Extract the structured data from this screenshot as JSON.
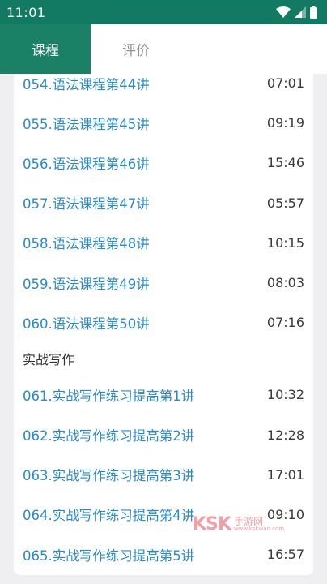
{
  "status_bar": {
    "time": "11:01"
  },
  "tabs": [
    {
      "label": "课程",
      "active": true
    },
    {
      "label": "评价",
      "active": false
    }
  ],
  "list": {
    "partial_item": {
      "title": "054.语法课程第44讲",
      "duration": "07:01"
    },
    "items_a": [
      {
        "title": "055.语法课程第45讲",
        "duration": "09:19"
      },
      {
        "title": "056.语法课程第46讲",
        "duration": "15:46"
      },
      {
        "title": "057.语法课程第47讲",
        "duration": "05:57"
      },
      {
        "title": "058.语法课程第48讲",
        "duration": "10:15"
      },
      {
        "title": "059.语法课程第49讲",
        "duration": "08:03"
      },
      {
        "title": "060.语法课程第50讲",
        "duration": "07:16"
      }
    ],
    "section_header": "实战写作",
    "items_b": [
      {
        "title": "061.实战写作练习提高第1讲",
        "duration": "10:32"
      },
      {
        "title": "062.实战写作练习提高第2讲",
        "duration": "12:28"
      },
      {
        "title": "063.实战写作练习提高第3讲",
        "duration": "17:01"
      },
      {
        "title": "064.实战写作练习提高第4讲",
        "duration": "09:10"
      },
      {
        "title": "065.实战写作练习提高第5讲",
        "duration": "16:57"
      }
    ]
  },
  "watermark": {
    "logo": "KSK",
    "text": "手游网",
    "url": "www.kskwan.com"
  },
  "colors": {
    "status_bar": "#127a62",
    "active_tab": "#1a8066",
    "title_text": "#2a8ac8",
    "background": "#efeff2"
  }
}
